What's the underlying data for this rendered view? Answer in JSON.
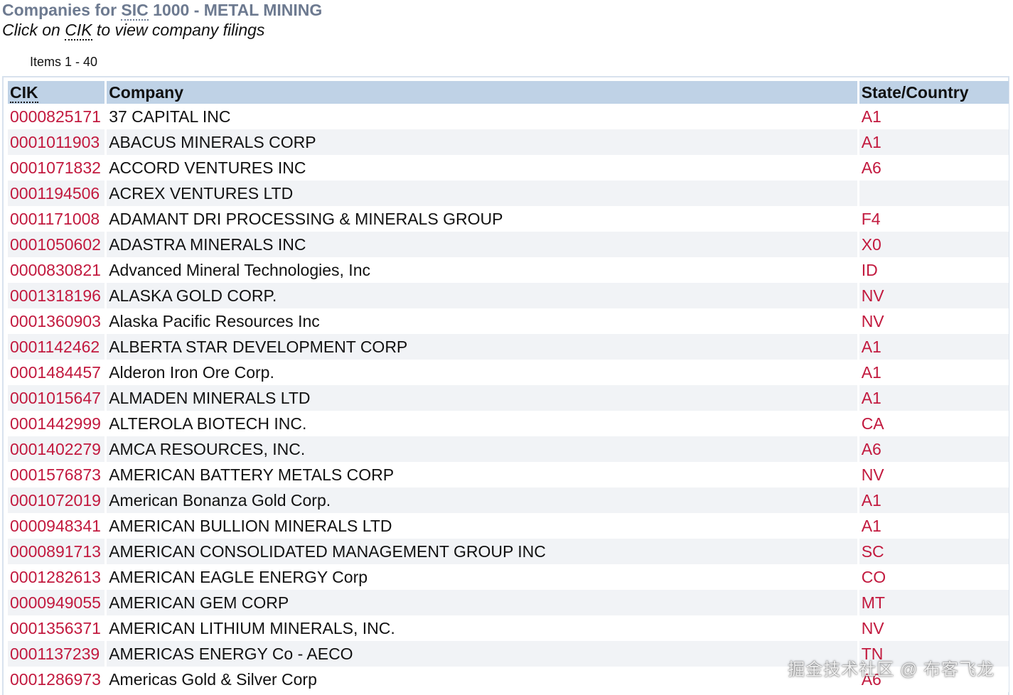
{
  "header": {
    "title_prefix": "Companies for ",
    "title_sic": "SIC",
    "title_suffix": " 1000 - METAL MINING",
    "subtitle_prefix": "Click on ",
    "subtitle_cik": "CIK",
    "subtitle_suffix": " to view company filings"
  },
  "pagination": {
    "items_label": "Items 1 - 40"
  },
  "table": {
    "columns": [
      "CIK",
      "Company",
      "State/Country"
    ],
    "rows": [
      {
        "cik": "0000825171",
        "company": "37 CAPITAL INC",
        "state": "A1"
      },
      {
        "cik": "0001011903",
        "company": "ABACUS MINERALS CORP",
        "state": "A1"
      },
      {
        "cik": "0001071832",
        "company": "ACCORD VENTURES INC",
        "state": "A6"
      },
      {
        "cik": "0001194506",
        "company": "ACREX VENTURES LTD",
        "state": ""
      },
      {
        "cik": "0001171008",
        "company": "ADAMANT DRI PROCESSING & MINERALS GROUP",
        "state": "F4"
      },
      {
        "cik": "0001050602",
        "company": "ADASTRA MINERALS INC",
        "state": "X0"
      },
      {
        "cik": "0000830821",
        "company": "Advanced Mineral Technologies, Inc",
        "state": "ID"
      },
      {
        "cik": "0001318196",
        "company": "ALASKA GOLD CORP.",
        "state": "NV"
      },
      {
        "cik": "0001360903",
        "company": "Alaska Pacific Resources Inc",
        "state": "NV"
      },
      {
        "cik": "0001142462",
        "company": "ALBERTA STAR DEVELOPMENT CORP",
        "state": "A1"
      },
      {
        "cik": "0001484457",
        "company": "Alderon Iron Ore Corp.",
        "state": "A1"
      },
      {
        "cik": "0001015647",
        "company": "ALMADEN MINERALS LTD",
        "state": "A1"
      },
      {
        "cik": "0001442999",
        "company": "ALTEROLA BIOTECH INC.",
        "state": "CA"
      },
      {
        "cik": "0001402279",
        "company": "AMCA RESOURCES, INC.",
        "state": "A6"
      },
      {
        "cik": "0001576873",
        "company": "AMERICAN BATTERY METALS CORP",
        "state": "NV"
      },
      {
        "cik": "0001072019",
        "company": "American Bonanza Gold Corp.",
        "state": "A1"
      },
      {
        "cik": "0000948341",
        "company": "AMERICAN BULLION MINERALS LTD",
        "state": "A1"
      },
      {
        "cik": "0000891713",
        "company": "AMERICAN CONSOLIDATED MANAGEMENT GROUP INC",
        "state": "SC"
      },
      {
        "cik": "0001282613",
        "company": "AMERICAN EAGLE ENERGY Corp",
        "state": "CO"
      },
      {
        "cik": "0000949055",
        "company": "AMERICAN GEM CORP",
        "state": "MT"
      },
      {
        "cik": "0001356371",
        "company": "AMERICAN LITHIUM MINERALS, INC.",
        "state": "NV"
      },
      {
        "cik": "0001137239",
        "company": "AMERICAS ENERGY Co - AECO",
        "state": "TN"
      },
      {
        "cik": "0001286973",
        "company": "Americas Gold & Silver Corp",
        "state": "A6"
      }
    ]
  },
  "watermark": {
    "text": "掘金技术社区 @ 布客飞龙"
  },
  "colors": {
    "link": "#c2193e",
    "header_bg": "#bfd2e6",
    "title": "#6d7a90",
    "stripe": "#f1f3f6"
  }
}
